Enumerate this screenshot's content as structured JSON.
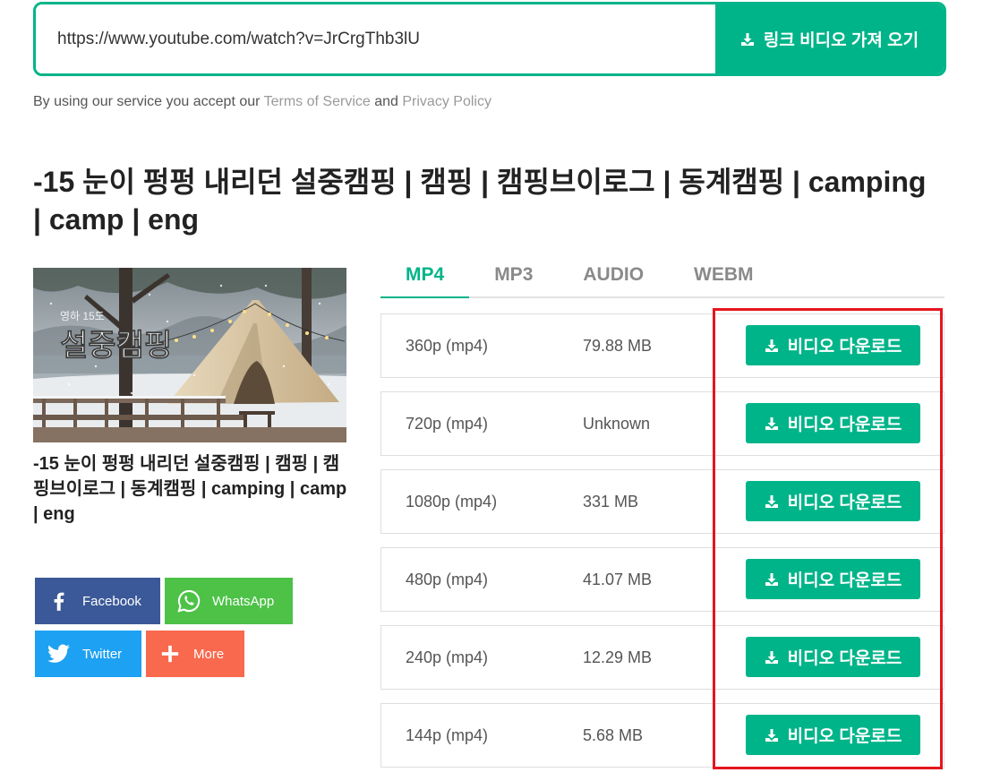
{
  "colors": {
    "accent": "#00b489",
    "highlight": "#e5151d",
    "facebook": "#3b5998",
    "whatsapp": "#4dc247",
    "twitter": "#1da1f2",
    "more": "#f8694d"
  },
  "search": {
    "url_value": "https://www.youtube.com/watch?v=JrCrgThb3lU",
    "submit_icon": "download-icon",
    "submit_label": "링크 비디오 가져 오기"
  },
  "terms": {
    "prefix": "By using our service you accept our",
    "terms_link": "Terms of Service",
    "conjunction": "and",
    "privacy_link": "Privacy Policy"
  },
  "video": {
    "title": "-15 눈이 펑펑 내리던 설중캠핑 | 캠핑 | 캠핑브이로그 | 동계캠핑 | camping | camp | eng",
    "thumbnail": {
      "overlay_small": "영하 15도",
      "overlay_large": "설중캠핑"
    },
    "caption": "-15 눈이 펑펑 내리던 설중캠핑 | 캠핑 | 캠핑브이로그 | 동계캠핑 | camping | camp | eng"
  },
  "share": [
    {
      "label": "Facebook",
      "icon": "facebook-icon"
    },
    {
      "label": "WhatsApp",
      "icon": "whatsapp-icon"
    },
    {
      "label": "Twitter",
      "icon": "twitter-icon"
    },
    {
      "label": "More",
      "icon": "plus-icon"
    }
  ],
  "tabs": [
    {
      "label": "MP4",
      "active": true
    },
    {
      "label": "MP3",
      "active": false
    },
    {
      "label": "AUDIO",
      "active": false
    },
    {
      "label": "WEBM",
      "active": false
    }
  ],
  "downloads": [
    {
      "quality": "360p (mp4)",
      "size": "79.88 MB",
      "button_label": "비디오 다운로드",
      "icon": "download-icon"
    },
    {
      "quality": "720p (mp4)",
      "size": "Unknown",
      "button_label": "비디오 다운로드",
      "icon": "download-icon"
    },
    {
      "quality": "1080p (mp4)",
      "size": "331 MB",
      "button_label": "비디오 다운로드",
      "icon": "download-icon"
    },
    {
      "quality": "480p (mp4)",
      "size": "41.07 MB",
      "button_label": "비디오 다운로드",
      "icon": "download-icon"
    },
    {
      "quality": "240p (mp4)",
      "size": "12.29 MB",
      "button_label": "비디오 다운로드",
      "icon": "download-icon"
    },
    {
      "quality": "144p (mp4)",
      "size": "5.68 MB",
      "button_label": "비디오 다운로드",
      "icon": "download-icon"
    }
  ]
}
